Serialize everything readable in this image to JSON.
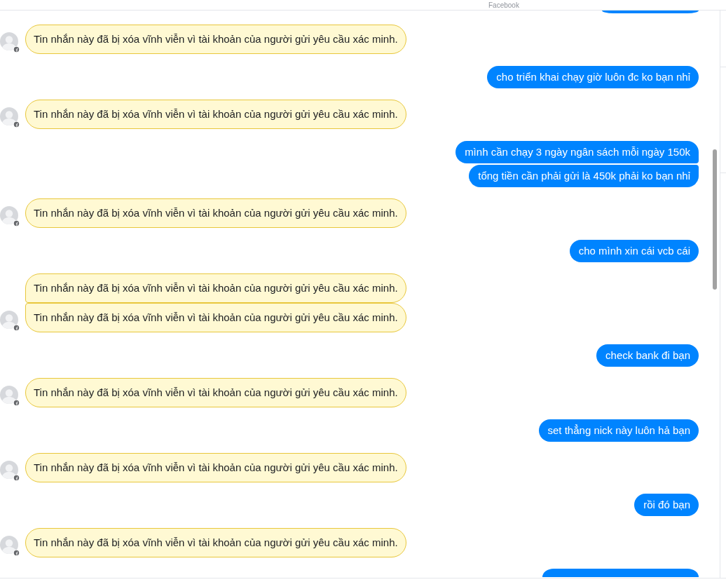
{
  "header": {
    "caption": "Facebook"
  },
  "thread": [
    {
      "kind": "sent",
      "messages": [
        {
          "kind": "cut_top"
        }
      ]
    },
    {
      "kind": "received",
      "messages": [
        {
          "kind": "text",
          "text": "Tin nhắn này đã bị xóa vĩnh viễn vì tài khoản của người gửi yêu cầu xác minh."
        }
      ]
    },
    {
      "kind": "sent",
      "messages": [
        {
          "kind": "text",
          "text": "cho triển khai chạy giờ luôn đc ko bạn nhỉ"
        }
      ]
    },
    {
      "kind": "received",
      "messages": [
        {
          "kind": "text",
          "text": "Tin nhắn này đã bị xóa vĩnh viễn vì tài khoản của người gửi yêu cầu xác minh."
        }
      ]
    },
    {
      "kind": "sent",
      "messages": [
        {
          "kind": "text",
          "text": "mình cần chạy 3 ngày ngân sách mỗi ngày 150k"
        },
        {
          "kind": "text",
          "text": "tổng tiền cần phải gửi là 450k phải ko bạn nhỉ"
        }
      ]
    },
    {
      "kind": "received",
      "messages": [
        {
          "kind": "text",
          "text": "Tin nhắn này đã bị xóa vĩnh viễn vì tài khoản của người gửi yêu cầu xác minh."
        }
      ]
    },
    {
      "kind": "sent",
      "messages": [
        {
          "kind": "text",
          "text": "cho mình xin cái vcb cái"
        }
      ]
    },
    {
      "kind": "received",
      "messages": [
        {
          "kind": "text",
          "text": "Tin nhắn này đã bị xóa vĩnh viễn vì tài khoản của người gửi yêu cầu xác minh."
        },
        {
          "kind": "text",
          "text": "Tin nhắn này đã bị xóa vĩnh viễn vì tài khoản của người gửi yêu cầu xác minh."
        }
      ]
    },
    {
      "kind": "sent",
      "messages": [
        {
          "kind": "text",
          "text": "check bank đi bạn"
        }
      ]
    },
    {
      "kind": "received",
      "messages": [
        {
          "kind": "text",
          "text": "Tin nhắn này đã bị xóa vĩnh viễn vì tài khoản của người gửi yêu cầu xác minh."
        }
      ]
    },
    {
      "kind": "sent",
      "messages": [
        {
          "kind": "text",
          "text": "set thẳng nick này luôn hả bạn"
        }
      ]
    },
    {
      "kind": "received",
      "messages": [
        {
          "kind": "text",
          "text": "Tin nhắn này đã bị xóa vĩnh viễn vì tài khoản của người gửi yêu cầu xác minh."
        }
      ]
    },
    {
      "kind": "sent",
      "messages": [
        {
          "kind": "text",
          "text": "rồi đó bạn"
        }
      ]
    },
    {
      "kind": "received",
      "messages": [
        {
          "kind": "text",
          "text": "Tin nhắn này đã bị xóa vĩnh viễn vì tài khoản của người gửi yêu cầu xác minh."
        }
      ]
    },
    {
      "kind": "sent",
      "messages": [
        {
          "kind": "cut_bottom"
        }
      ]
    }
  ]
}
